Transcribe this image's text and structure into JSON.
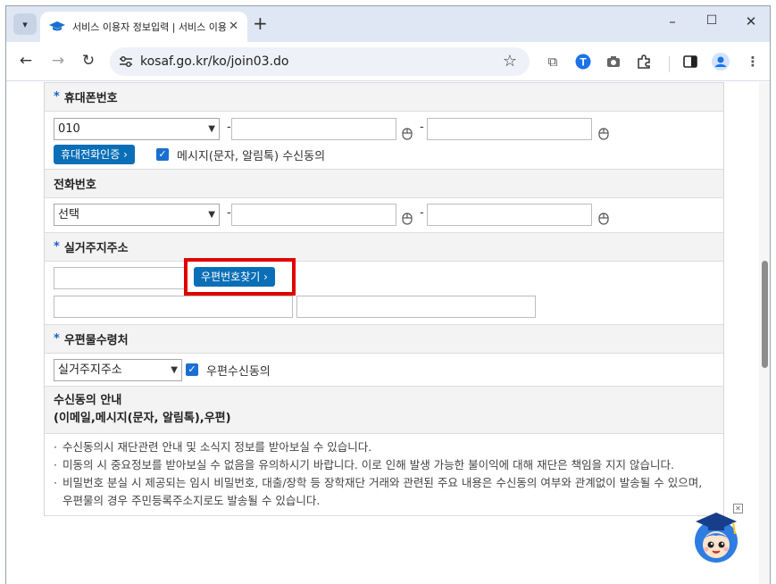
{
  "browser": {
    "tab_title": "서비스 이용자 정보입력 | 서비스 이용",
    "url": "kosaf.go.kr/ko/join03.do",
    "win_minimize": "–",
    "win_maximize": "☐",
    "win_close": "✕"
  },
  "form": {
    "mobile": {
      "heading": "휴대폰번호",
      "prefix_value": "010",
      "dash": "-",
      "verify_button": "휴대전화인증",
      "consent_label": "메시지(문자, 알림톡) 수신동의",
      "consent_checked": true
    },
    "phone": {
      "heading": "전화번호",
      "prefix_value": "선택",
      "dash": "-"
    },
    "address": {
      "heading": "실거주지주소",
      "postcode_button": "우편번호찾기"
    },
    "mail_recipient": {
      "heading": "우편물수령처",
      "select_value": "실거주지주소",
      "consent_label": "우편수신동의",
      "consent_checked": true
    },
    "notice": {
      "heading_line1": "수신동의 안내",
      "heading_line2": "(이메일,메시지(문자, 알림톡),우편)",
      "items": [
        "수신동의시 재단관련 안내 및 소식지 정보를 받아보실 수 있습니다.",
        "미동의 시 중요정보를 받아보실 수 없음을 유의하시기 바랍니다. 이로 인해 발생 가능한 불이익에 대해 재단은 책임을 지지 않습니다.",
        "비밀번호 분실 시 제공되는 임시 비밀번호, 대출/장학 등 장학재단 거래와 관련된 주요 내용은 수신동의 여부와 관계없이 발송될 수 있으며, 우편물의 경우 주민등록주소지로도 발송될 수 있습니다."
      ]
    }
  },
  "colors": {
    "accent_blue": "#0b6fb7",
    "highlight_red": "#e00000",
    "required_mark": "#1c62c4"
  }
}
